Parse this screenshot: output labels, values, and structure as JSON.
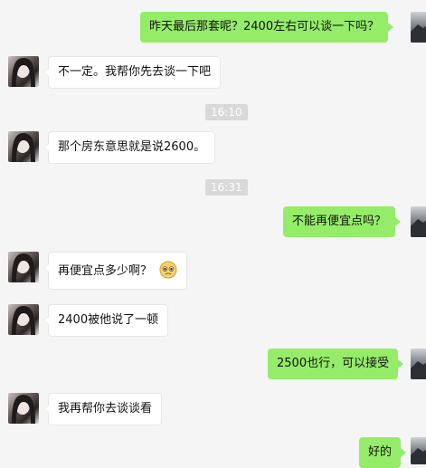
{
  "messages": [
    {
      "id": "m1",
      "side": "right",
      "text": "昨天最后那套呢？2400左右可以谈一下吗？"
    },
    {
      "id": "m2",
      "side": "left",
      "text": "不一定。我帮你先去谈一下吧"
    },
    {
      "id": "t1",
      "type": "time",
      "text": "16:10"
    },
    {
      "id": "m3",
      "side": "left",
      "text": "那个房东意思就是说2600。"
    },
    {
      "id": "t2",
      "type": "time",
      "text": "16:31"
    },
    {
      "id": "m4",
      "side": "right",
      "text": "不能再便宜点吗？"
    },
    {
      "id": "m5",
      "side": "left",
      "text": "再便宜点多少啊？",
      "emoji": "pleading-face-icon"
    },
    {
      "id": "m6",
      "side": "left",
      "text": "2400被他说了一顿"
    },
    {
      "id": "m7",
      "side": "right",
      "text": "2500也行，可以接受"
    },
    {
      "id": "m8",
      "side": "left",
      "text": "我再帮你去谈谈看"
    },
    {
      "id": "m9",
      "side": "right",
      "text": "好的"
    }
  ],
  "colors": {
    "background": "#f5f5f5",
    "outgoing_bubble": "#95ec69",
    "incoming_bubble": "#ffffff",
    "time_chip": "#d9d9d9"
  }
}
